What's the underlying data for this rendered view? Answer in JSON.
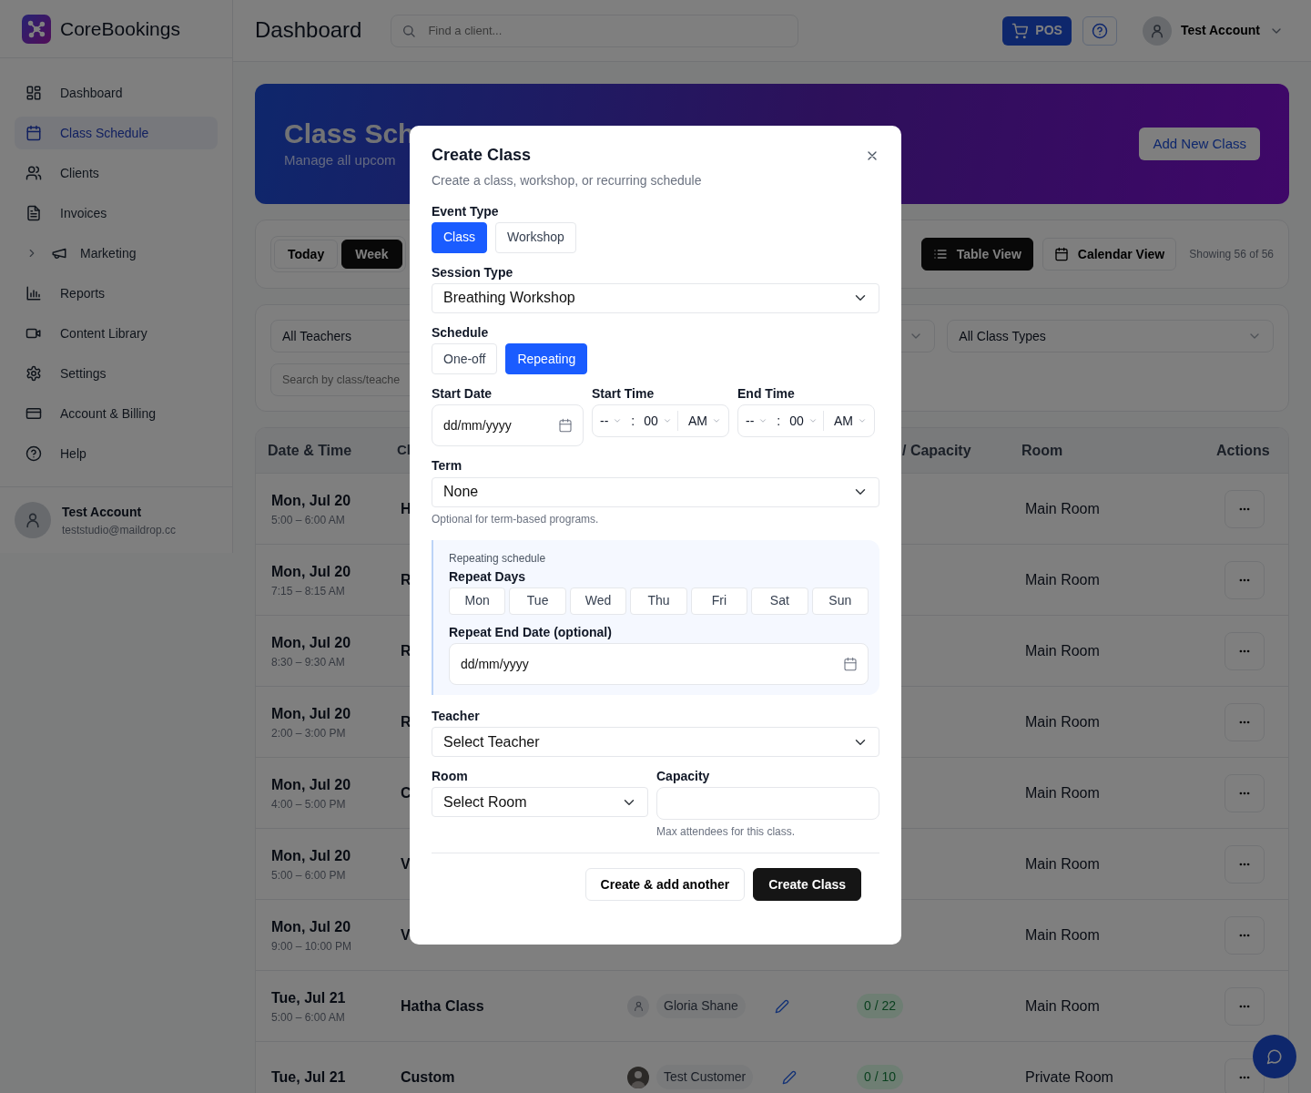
{
  "app": {
    "brand": "CoreBookings"
  },
  "sidebar": {
    "items": [
      {
        "label": "Dashboard",
        "selected": false
      },
      {
        "label": "Class Schedule",
        "selected": true
      },
      {
        "label": "Clients",
        "selected": false
      },
      {
        "label": "Invoices",
        "selected": false
      },
      {
        "label": "Marketing",
        "selected": false,
        "kind": "group",
        "expanded": false
      },
      {
        "label": "Reports",
        "selected": false
      },
      {
        "label": "Content Library",
        "selected": false
      },
      {
        "label": "Settings",
        "selected": false
      },
      {
        "label": "Account & Billing",
        "selected": false
      },
      {
        "label": "Help",
        "selected": false
      }
    ],
    "user": {
      "name": "Test Account",
      "email": "teststudio@maildrop.cc"
    }
  },
  "header": {
    "title": "Dashboard",
    "search": {
      "placeholder": "Find a client..."
    },
    "pos_button": "POS",
    "account": "Test Account"
  },
  "banner": {
    "title": "Class Sch",
    "subtitle": "Manage all upcom",
    "button": "Add New Class"
  },
  "toolbar": {
    "ranges": [
      {
        "label": "Today",
        "selected": false
      },
      {
        "label": "Week",
        "selected": true
      }
    ],
    "views": [
      {
        "label": "Table View",
        "selected": true
      },
      {
        "label": "Calendar View",
        "selected": false
      }
    ],
    "count": "Showing 56 of 56"
  },
  "filters": {
    "teacher": "All Teachers",
    "class_types": "All Class Types",
    "search": {
      "placeholder": "Search by class/teache"
    }
  },
  "table": {
    "columns": [
      "Date & Time",
      "Cl",
      "/ Capacity",
      "Room",
      "Actions"
    ],
    "rows": [
      {
        "date": "Mon, Jul 20",
        "time": "5:00 – 6:00 AM",
        "class": "H",
        "room": "Main Room"
      },
      {
        "date": "Mon, Jul 20",
        "time": "7:15 – 8:15 AM",
        "class": "R",
        "room": "Main Room"
      },
      {
        "date": "Mon, Jul 20",
        "time": "8:30 – 9:30 AM",
        "class": "R",
        "room": "Main Room"
      },
      {
        "date": "Mon, Jul 20",
        "time": "2:00 – 3:00 PM",
        "class": "R",
        "room": "Main Room"
      },
      {
        "date": "Mon, Jul 20",
        "time": "4:00 – 5:00 PM",
        "class": "C",
        "room": "Main Room"
      },
      {
        "date": "Mon, Jul 20",
        "time": "5:00 – 6:00 PM",
        "class": "V",
        "room": "Main Room"
      },
      {
        "date": "Mon, Jul 20",
        "time": "9:00 – 10:00 PM",
        "class": "V",
        "room": "Main Room"
      },
      {
        "date": "Tue, Jul 21",
        "time": "5:00 – 6:00 AM",
        "class": "Hatha Class",
        "teacher": {
          "name": "Gloria Shane",
          "kind": "placeholder"
        },
        "booked": "0 / 22",
        "room": "Main Room"
      },
      {
        "date": "Tue, Jul 21",
        "class": "Custom",
        "teacher": {
          "name": "Test Customer",
          "kind": "photo"
        },
        "booked": "0 / 10",
        "room": "Private Room"
      }
    ]
  },
  "modal": {
    "title": "Create Class",
    "subtitle": "Create a class, workshop, or recurring schedule",
    "event_type": {
      "label": "Event Type",
      "options": [
        {
          "label": "Class",
          "selected": true
        },
        {
          "label": "Workshop",
          "selected": false
        }
      ]
    },
    "session_type": {
      "label": "Session Type",
      "value": "Breathing Workshop"
    },
    "schedule": {
      "label": "Schedule",
      "options": [
        {
          "label": "One-off",
          "selected": false
        },
        {
          "label": "Repeating",
          "selected": true
        }
      ]
    },
    "start_date": {
      "label": "Start Date",
      "placeholder": "dd/mm/yyyy"
    },
    "start_time": {
      "label": "Start Time",
      "hour": "--",
      "separator": ":",
      "minute": "00",
      "period": "AM"
    },
    "end_time": {
      "label": "End Time",
      "hour": "--",
      "separator": ":",
      "minute": "00",
      "period": "AM"
    },
    "term": {
      "label": "Term",
      "value": "None",
      "help": "Optional for term-based programs."
    },
    "repeating": {
      "title": "Repeating schedule",
      "days_label": "Repeat Days",
      "days": [
        {
          "label": "Mon",
          "selected": false
        },
        {
          "label": "Tue",
          "selected": false
        },
        {
          "label": "Wed",
          "selected": false
        },
        {
          "label": "Thu",
          "selected": false
        },
        {
          "label": "Fri",
          "selected": false
        },
        {
          "label": "Sat",
          "selected": false
        },
        {
          "label": "Sun",
          "selected": false
        }
      ],
      "end_label": "Repeat End Date (optional)",
      "end_placeholder": "dd/mm/yyyy"
    },
    "teacher": {
      "label": "Teacher",
      "value": "Select Teacher"
    },
    "room": {
      "label": "Room",
      "value": "Select Room"
    },
    "capacity": {
      "label": "Capacity",
      "help": "Max attendees for this class."
    },
    "buttons": [
      {
        "label": "Create & add another",
        "kind": "secondary"
      },
      {
        "label": "Create Class",
        "kind": "primary"
      }
    ]
  }
}
